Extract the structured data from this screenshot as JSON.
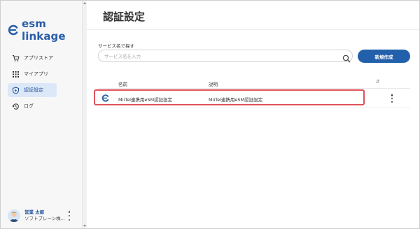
{
  "app": {
    "brand_name": "esm linkage",
    "brand_color": "#2a5ea8",
    "accent_color": "#2360ab",
    "highlight_color": "#e0525a"
  },
  "sidebar": {
    "items": [
      {
        "label": "アプリストア",
        "icon": "cart-icon",
        "active": false
      },
      {
        "label": "マイアプリ",
        "icon": "grid-icon",
        "active": false
      },
      {
        "label": "認証設定",
        "icon": "shield-icon",
        "active": true
      },
      {
        "label": "ログ",
        "icon": "history-icon",
        "active": false
      }
    ]
  },
  "user": {
    "name": "営業 太郎",
    "company": "ソフトブレーン株..."
  },
  "page": {
    "title": "認証設定"
  },
  "search": {
    "label": "サービス名で探す",
    "placeholder": "サービス名を入力",
    "value": ""
  },
  "toolbar": {
    "new_button_label": "新規作成"
  },
  "table": {
    "columns": {
      "name": "名前",
      "description": "説明",
      "sort_symbol": "⇵"
    },
    "rows": [
      {
        "name": "MiiTel連携用eSM認証設定",
        "description": "MiiTel連携用eSM認証設定"
      }
    ]
  }
}
